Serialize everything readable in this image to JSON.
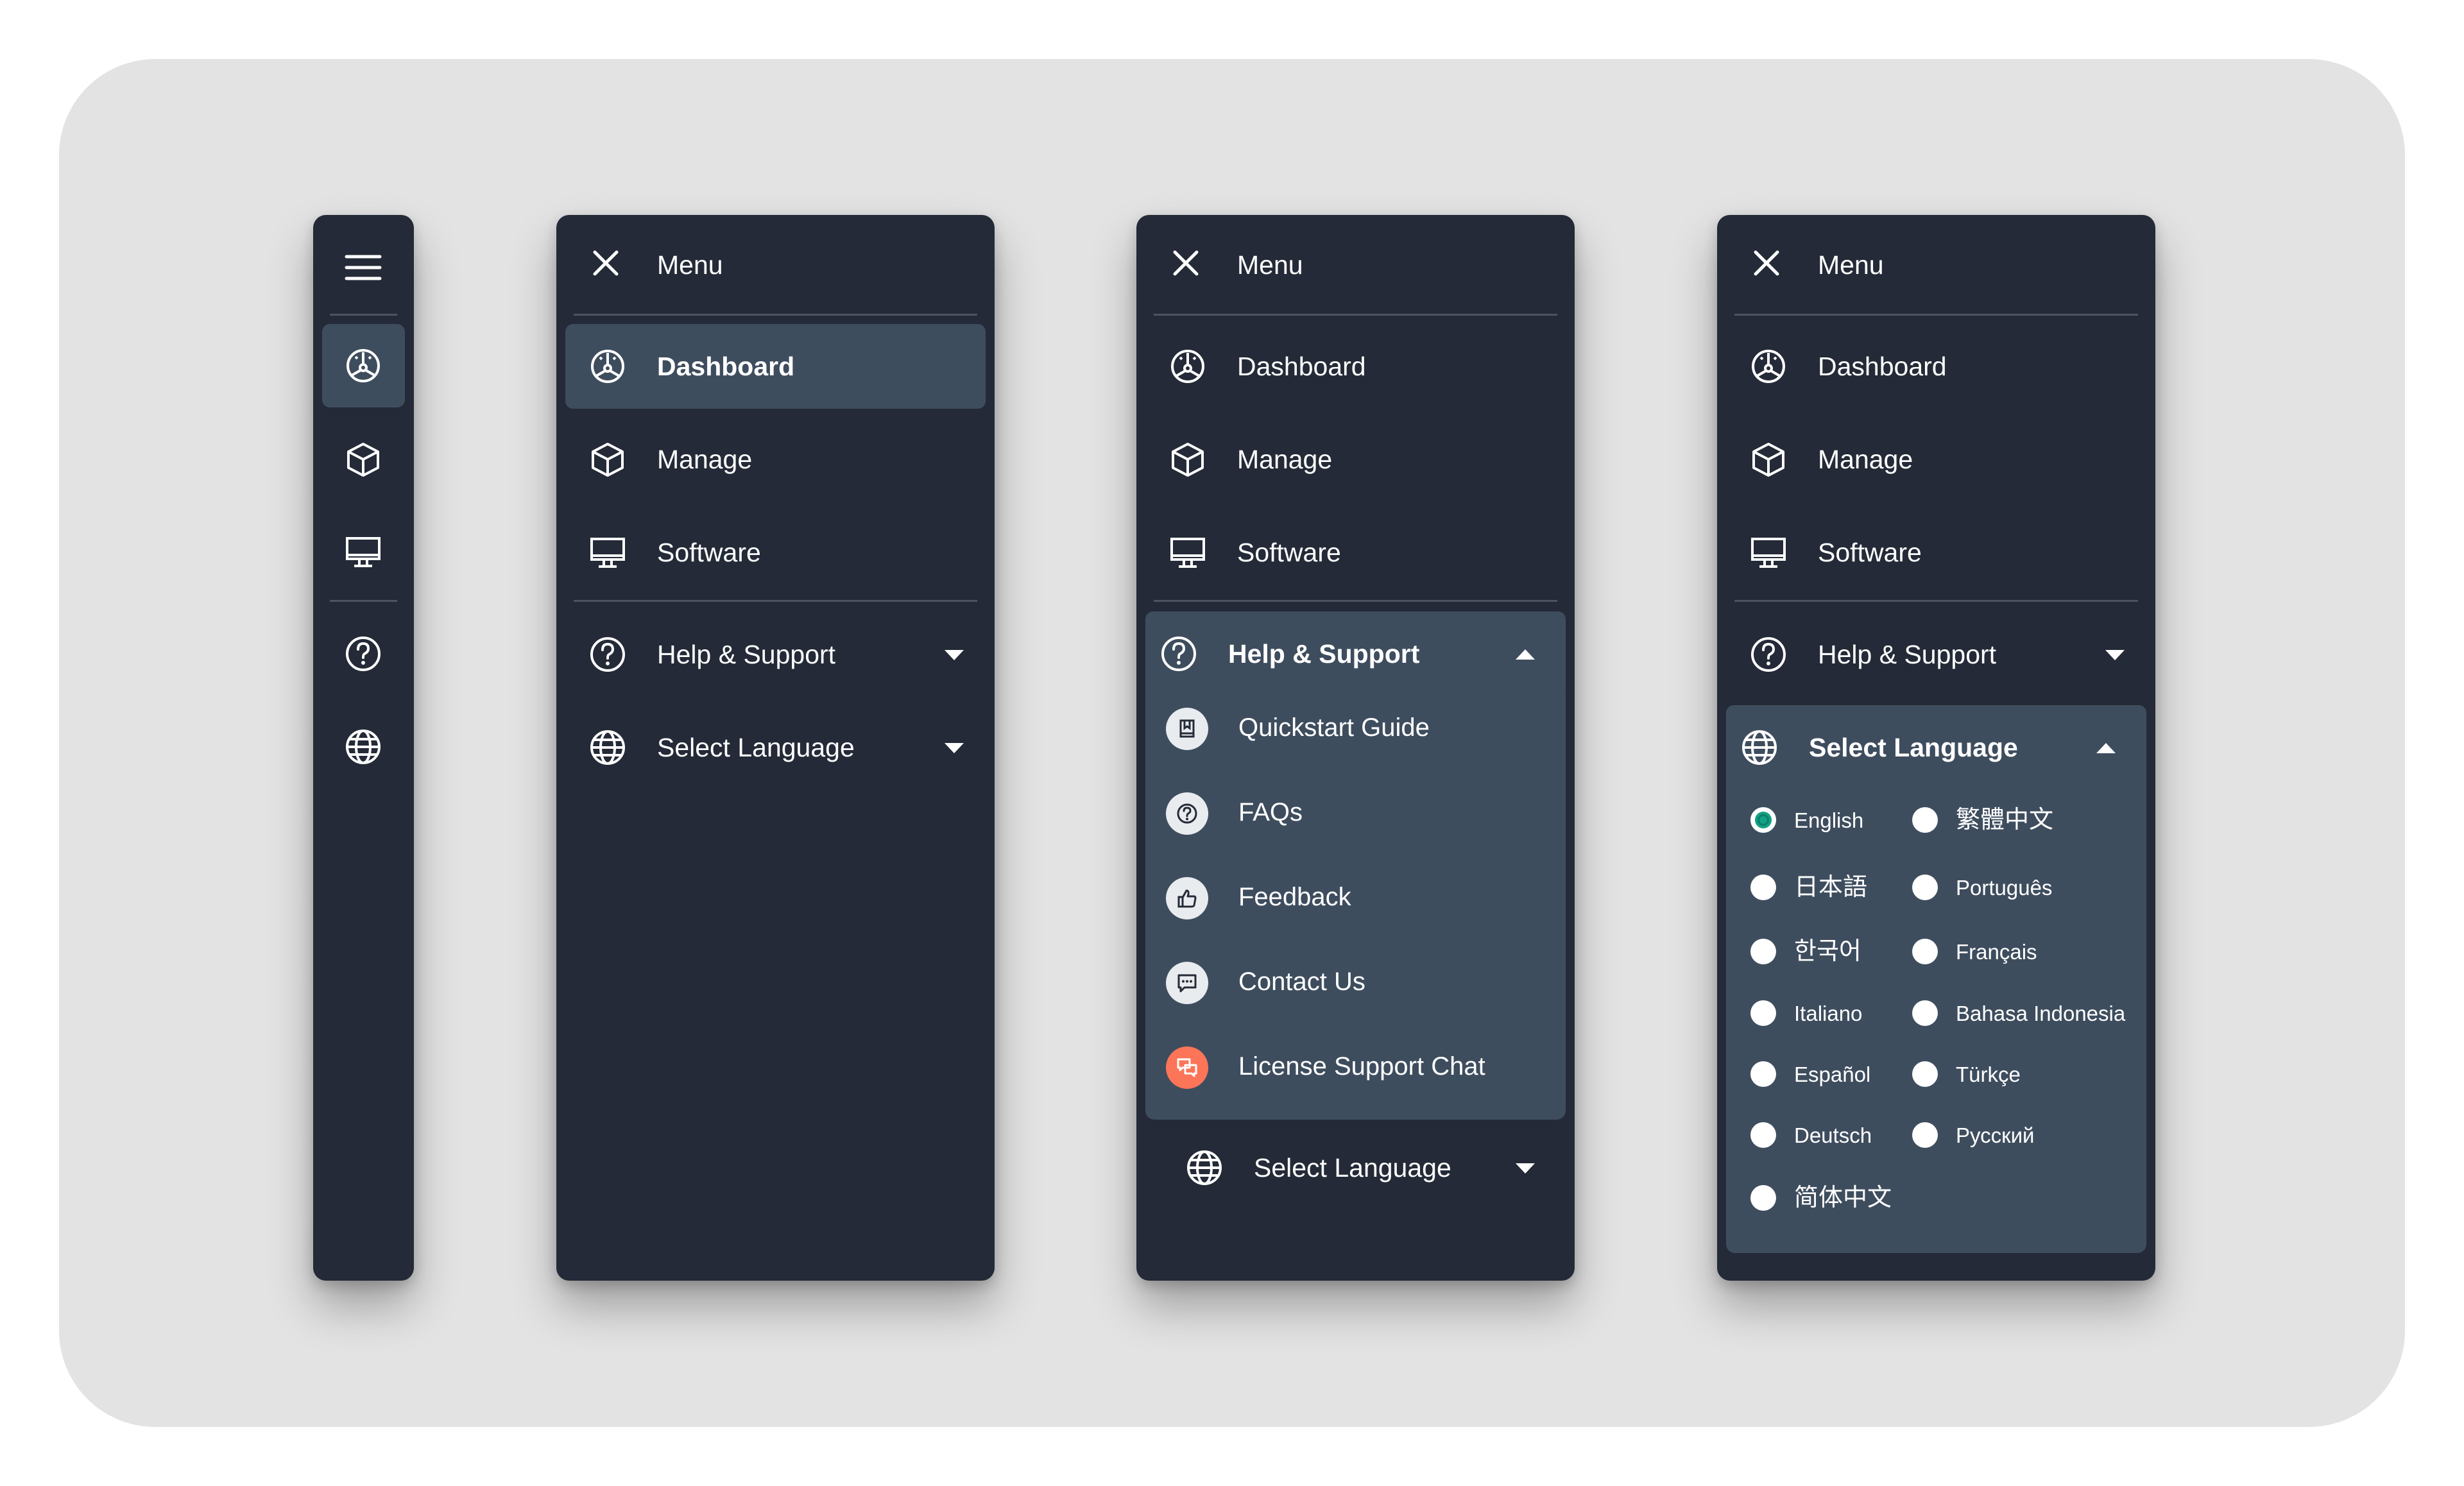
{
  "menu": {
    "title": "Menu",
    "items": {
      "dashboard": "Dashboard",
      "manage": "Manage",
      "software": "Software",
      "help": "Help & Support",
      "language": "Select Language"
    }
  },
  "help_submenu": [
    {
      "label": "Quickstart Guide",
      "icon": "book-icon"
    },
    {
      "label": "FAQs",
      "icon": "question-icon"
    },
    {
      "label": "Feedback",
      "icon": "thumbs-up-icon"
    },
    {
      "label": "Contact Us",
      "icon": "chat-icon"
    },
    {
      "label": "License Support Chat",
      "icon": "chat-bubbles-icon",
      "accent": "#fd7558"
    }
  ],
  "languages": [
    {
      "label": "English",
      "selected": true
    },
    {
      "label": "繁體中文",
      "selected": false
    },
    {
      "label": "日本語",
      "selected": false
    },
    {
      "label": "Português",
      "selected": false
    },
    {
      "label": "한국어",
      "selected": false
    },
    {
      "label": "Français",
      "selected": false
    },
    {
      "label": "Italiano",
      "selected": false
    },
    {
      "label": "Bahasa Indonesia",
      "selected": false
    },
    {
      "label": "Español",
      "selected": false
    },
    {
      "label": "Türkçe",
      "selected": false
    },
    {
      "label": "Deutsch",
      "selected": false
    },
    {
      "label": "Русский",
      "selected": false
    },
    {
      "label": "简体中文",
      "selected": false
    }
  ],
  "colors": {
    "panel": "#242a37",
    "active": "#3e4d5e",
    "background": "#e3e3e3",
    "radio_selected": "#11a184",
    "accent": "#fd7558"
  }
}
